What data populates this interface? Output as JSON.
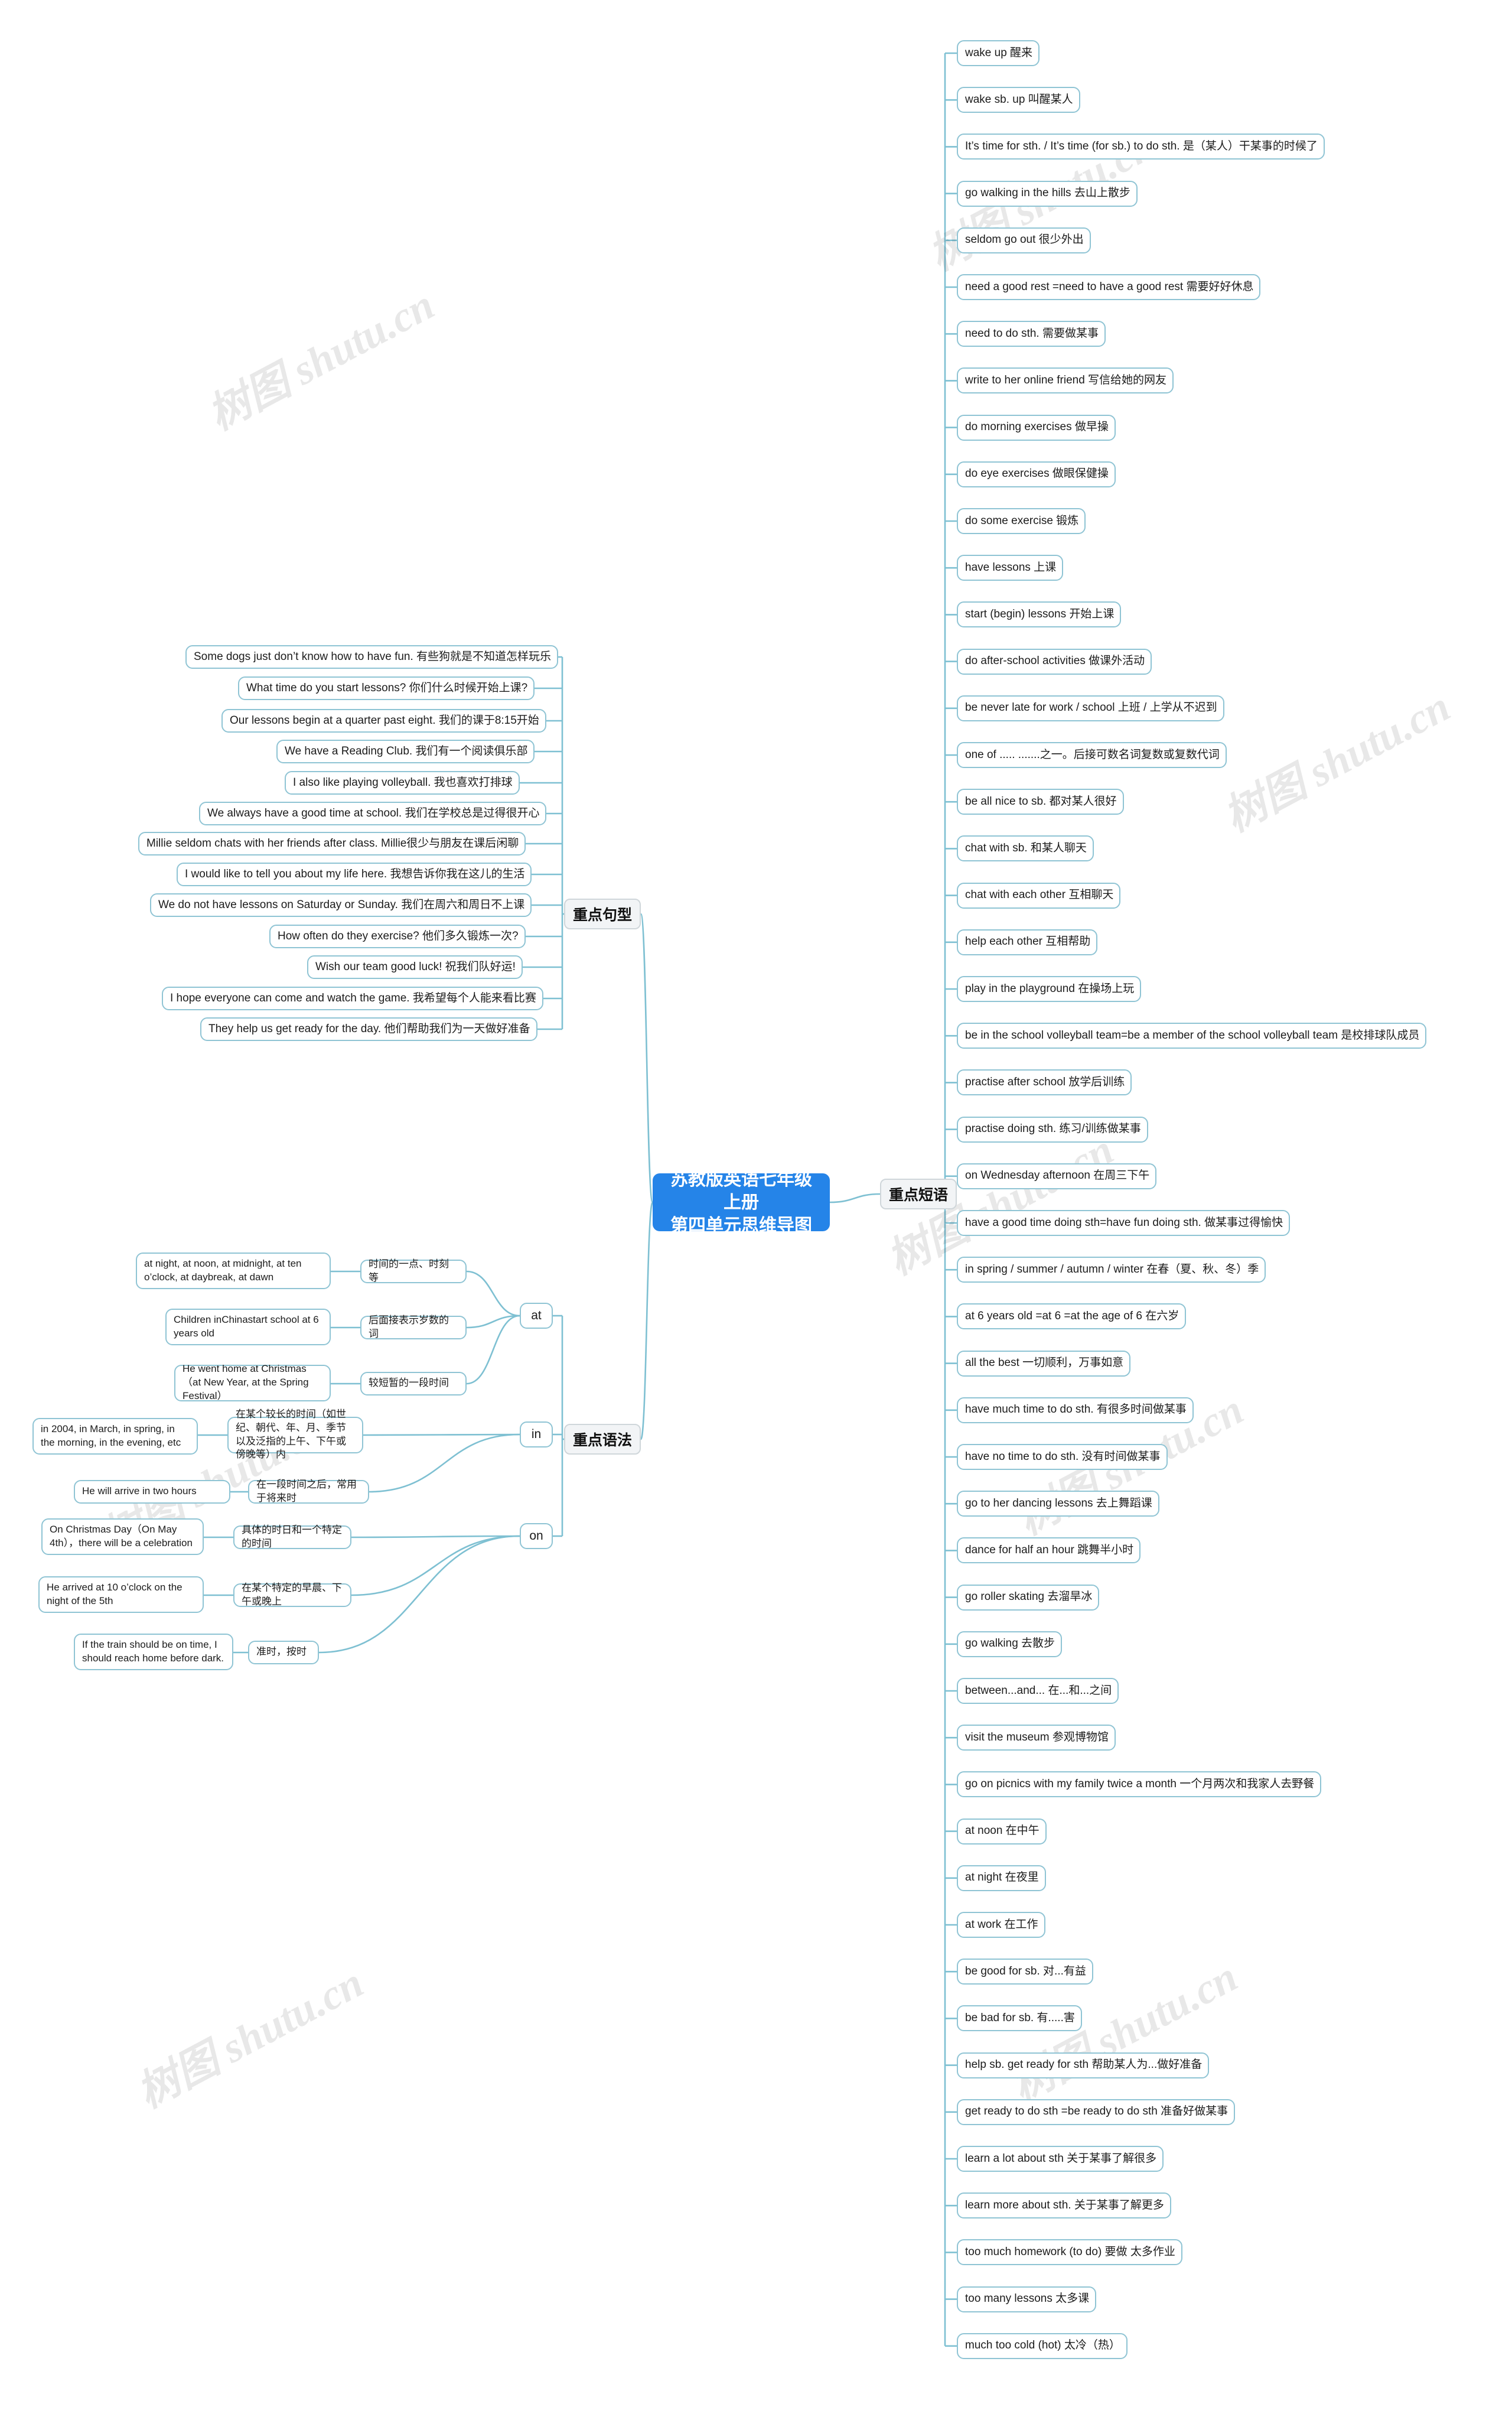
{
  "root": {
    "title": "苏教版英语七年级上册\n第四单元思维导图",
    "color": "#2584e8"
  },
  "branches": {
    "phrases": "重点短语",
    "sentences": "重点句型",
    "grammar": "重点语法"
  },
  "phrases": [
    "wake up      醒来",
    "wake sb. up   叫醒某人",
    "It’s time for sth. / It’s time (for sb.) to do sth.    是（某人）干某事的时候了",
    "go walking in the hills   去山上散步",
    "seldom go out    很少外出",
    "need a good rest =need to have a good rest   需要好好休息",
    "need to do sth.   需要做某事",
    "write to her online friend   写信给她的网友",
    "do morning exercises    做早操",
    "do eye exercises    做眼保健操",
    "do some exercise     锻炼",
    "have lessons     上课",
    "start (begin) lessons    开始上课",
    "do after-school activities   做课外活动",
    "be never late for work / school  上班 / 上学从不迟到",
    "one of .....     .......之一。后接可数名词复数或复数代词",
    "be all nice to sb.    都对某人很好",
    "chat with sb.  和某人聊天",
    "chat with each other   互相聊天",
    "help each other     互相帮助",
    "play in the playground     在操场上玩",
    "be in the school volleyball team=be a member of the school volleyball team   是校排球队成员",
    "practise after school     放学后训练",
    "practise doing sth.   练习/训练做某事",
    "on Wednesday afternoon    在周三下午",
    "have a good time doing sth=have fun doing sth.    做某事过得愉快",
    "in spring / summer / autumn / winter 在春（夏、秋、冬）季",
    "at 6 years old =at 6 =at the age of 6   在六岁",
    "all the best    一切顺利，万事如意",
    "have much time to do sth.   有很多时间做某事",
    "have no time to do sth.   没有时间做某事",
    "go to her dancing lessons   去上舞蹈课",
    "dance for half an hour   跳舞半小时",
    "go roller skating    去溜旱冰",
    "go walking   去散步",
    "between...and...  在...和...之间",
    "visit the  museum    参观博物馆",
    "go on picnics with my family twice a month    一个月两次和我家人去野餐",
    "at noon   在中午",
    "at night   在夜里",
    "at work   在工作",
    "be good for sb.  对...有益",
    "be bad for sb.    有.....害",
    "help sb. get ready for sth   帮助某人为...做好准备",
    "get ready to do sth =be ready to do sth    准备好做某事",
    "learn a lot about sth  关于某事了解很多",
    "learn more about sth. 关于某事了解更多",
    "too much homework (to do)  要做 太多作业",
    "too many lessons   太多课",
    "much too cold (hot)  太冷（热）"
  ],
  "sentences": [
    "Some dogs just don’t know how to have fun.    有些狗就是不知道怎样玩乐",
    "What time do you start lessons?     你们什么时候开始上课?",
    "Our lessons begin at a quarter past eight.   我们的课于8:15开始",
    "We have a Reading Club.    我们有一个阅读俱乐部",
    "I also like playing volleyball.   我也喜欢打排球",
    "We always have a good time at school.  我们在学校总是过得很开心",
    "Millie seldom chats with her friends after class.     Millie很少与朋友在课后闲聊",
    "I would like to tell you about my life here.   我想告诉你我在这儿的生活",
    "We do not have lessons on Saturday or Sunday.   我们在周六和周日不上课",
    "How often do they exercise?   他们多久锻炼一次?",
    "Wish our team good luck!   祝我们队好运!",
    "I hope everyone can come and watch the game.   我希望每个人能来看比赛",
    "They help us get ready for the day.    他们帮助我们为一天做好准备"
  ],
  "grammar": {
    "at": {
      "label": "at",
      "rules": [
        {
          "example": "at night, at noon, at midnight, at ten o’clock, at daybreak, at dawn",
          "note": "时间的一点、时刻等"
        },
        {
          "example": "Children inChinastart school at 6 years old",
          "note": "后面接表示岁数的词"
        },
        {
          "example": "He went home at Christmas （at New Year, at the Spring Festival）",
          "note": "较短暂的一段时间"
        }
      ]
    },
    "in": {
      "label": "in",
      "rules": [
        {
          "example": "in 2004, in March, in spring, in the morning, in the evening, etc",
          "note": "在某个较长的时间（如世纪、朝代、年、月、季节以及泛指的上午、下午或傍晚等）内"
        },
        {
          "example": "He will arrive in two hours",
          "note": "在一段时间之后，常用于将来时"
        }
      ]
    },
    "on": {
      "label": "on",
      "rules": [
        {
          "example": "On Christmas Day（On May 4th），there will be a celebration",
          "note": "具体的时日和一个特定的时间"
        },
        {
          "example": "He arrived at 10 o’clock on the night of the 5th",
          "note": "在某个特定的早晨、下午或晚上"
        },
        {
          "example": "If the train should be on time, I should reach home before dark.",
          "note": "准时，按时"
        }
      ]
    }
  },
  "watermarks": [
    "树图 shutu.cn",
    "树图 shutu.cn",
    "树图 shutu.cn",
    "树图 shutu.cn",
    "树图 shutu.cn",
    "树图 shutu.cn",
    "树图 shutu.cn",
    "树图 shutu.cn"
  ]
}
